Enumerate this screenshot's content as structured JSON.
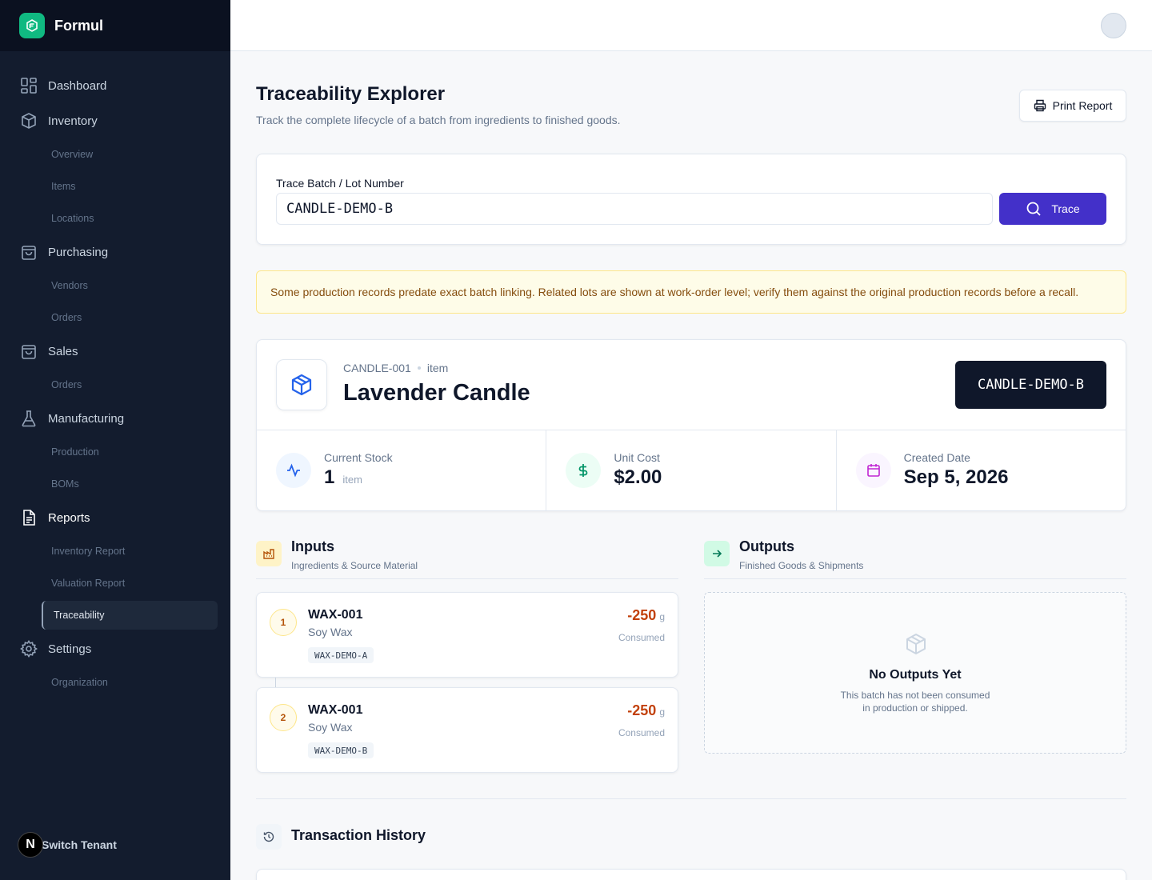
{
  "brand": {
    "name": "Formul"
  },
  "sidebar": {
    "nav": [
      {
        "label": "Dashboard",
        "icon": "grid-icon",
        "children": []
      },
      {
        "label": "Inventory",
        "icon": "box-icon",
        "children": [
          "Overview",
          "Items",
          "Locations"
        ]
      },
      {
        "label": "Purchasing",
        "icon": "bag-icon",
        "children": [
          "Vendors",
          "Orders"
        ]
      },
      {
        "label": "Sales",
        "icon": "bag-icon",
        "children": [
          "Orders"
        ]
      },
      {
        "label": "Manufacturing",
        "icon": "flask-icon",
        "children": [
          "Production",
          "BOMs"
        ]
      },
      {
        "label": "Reports",
        "icon": "document-icon",
        "children": [
          "Inventory Report",
          "Valuation Report",
          "Traceability"
        ]
      },
      {
        "label": "Settings",
        "icon": "gear-icon",
        "children": [
          "Organization"
        ]
      }
    ],
    "switch_label": "Switch Tenant",
    "avatar_letter": "N"
  },
  "page": {
    "title": "Traceability Explorer",
    "subtitle": "Track the complete lifecycle of a batch from ingredients to finished goods.",
    "print_label": "Print Report"
  },
  "search": {
    "label": "Trace Batch / Lot Number",
    "value": "CANDLE-DEMO-B",
    "button_label": "Trace"
  },
  "warning": "Some production records predate exact batch linking. Related lots are shown at work-order level; verify them against the original production records before a recall.",
  "item": {
    "sku": "CANDLE-001",
    "type": "item",
    "name": "Lavender Candle",
    "lot": "CANDLE-DEMO-B",
    "stats": {
      "stock_label": "Current Stock",
      "stock_value": "1",
      "stock_unit": "item",
      "cost_label": "Unit Cost",
      "cost_value": "$2.00",
      "date_label": "Created Date",
      "date_value": "Sep 5, 2026"
    }
  },
  "inputs": {
    "title": "Inputs",
    "subtitle": "Ingredients & Source Material",
    "items": [
      {
        "num": "1",
        "sku": "WAX-001",
        "name": "Soy Wax",
        "lot": "WAX-DEMO-A",
        "qty": "-250",
        "unit": "g",
        "status": "Consumed"
      },
      {
        "num": "2",
        "sku": "WAX-001",
        "name": "Soy Wax",
        "lot": "WAX-DEMO-B",
        "qty": "-250",
        "unit": "g",
        "status": "Consumed"
      }
    ]
  },
  "outputs": {
    "title": "Outputs",
    "subtitle": "Finished Goods & Shipments",
    "empty_title": "No Outputs Yet",
    "empty_text": "This batch has not been consumed in production or shipped."
  },
  "history": {
    "title": "Transaction History"
  },
  "colors": {
    "sidebar_bg": "#131c2e",
    "brand_accent": "#10b981",
    "primary": "#4330c9",
    "warning_bg": "#fefce8",
    "qty_negative": "#c2410c"
  }
}
